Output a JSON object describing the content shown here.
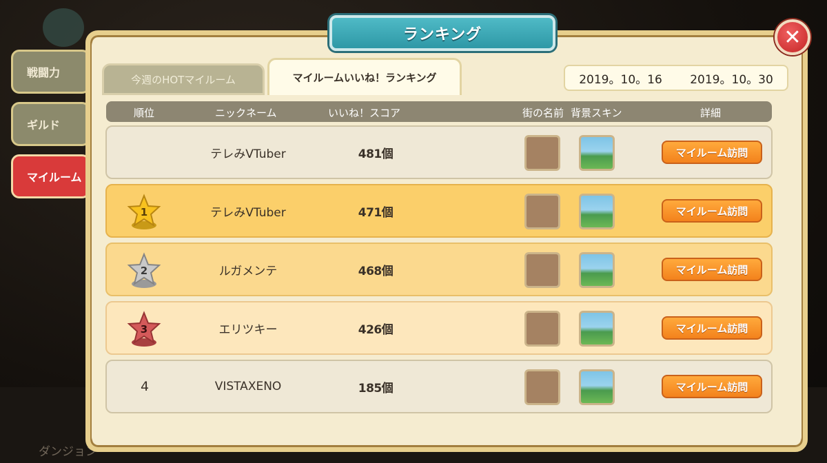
{
  "title": "ランキング",
  "side_tabs": [
    {
      "label": "戦闘力"
    },
    {
      "label": "ギルド"
    },
    {
      "label": "マイルーム"
    }
  ],
  "tabs": [
    {
      "label": "今週のHOTマイルーム"
    },
    {
      "label": "マイルームいいね！ランキング"
    }
  ],
  "date_range": {
    "start": "2019。10。16",
    "end": "2019。10。30"
  },
  "columns": {
    "rank": "順位",
    "nickname": "ニックネーム",
    "score": "いいね！スコア",
    "town": "街の名前",
    "skin": "背景スキン",
    "detail": "詳細"
  },
  "rows": [
    {
      "rank": "",
      "medal": "none",
      "nickname": "テレみVTuber",
      "score": "481個",
      "button": "マイルーム訪問"
    },
    {
      "rank": "1",
      "medal": "gold",
      "nickname": "テレみVTuber",
      "score": "471個",
      "button": "マイルーム訪問"
    },
    {
      "rank": "2",
      "medal": "silver",
      "nickname": "ルガメンテ",
      "score": "468個",
      "button": "マイルーム訪問"
    },
    {
      "rank": "3",
      "medal": "bronze",
      "nickname": "エリツキー",
      "score": "426個",
      "button": "マイルーム訪問"
    },
    {
      "rank": "4",
      "medal": "none",
      "nickname": "VISTAXENO",
      "score": "185個",
      "button": "マイルーム訪問"
    }
  ],
  "background_footer": {
    "left_label": "ダンジョン"
  },
  "colors": {
    "gold": "#f8c21f",
    "silver": "#c9c9c9",
    "bronze": "#d45a5a",
    "accent": "#f3821c",
    "banner": "#2e98a6"
  }
}
